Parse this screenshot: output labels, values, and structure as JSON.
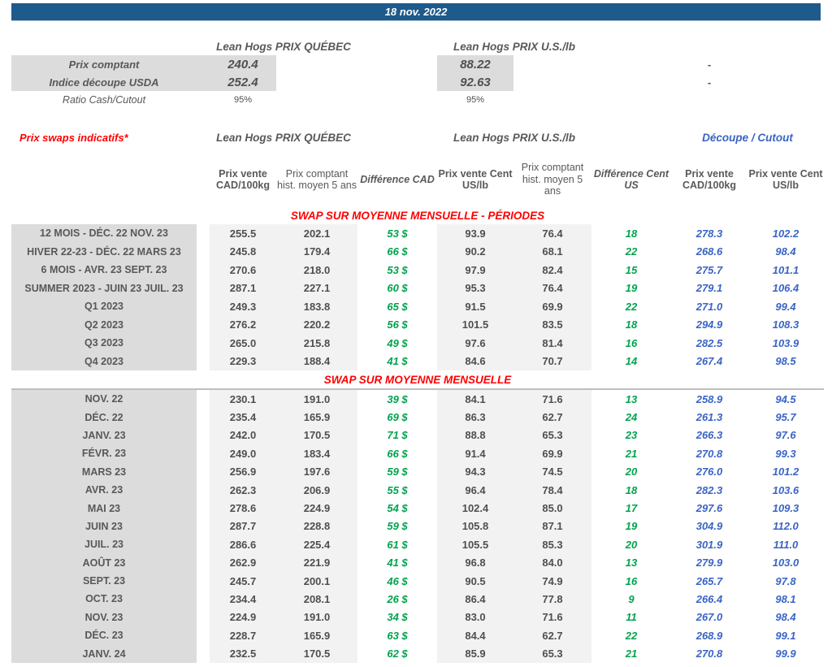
{
  "title_bar": {
    "date": "18 nov. 2022"
  },
  "top_section": {
    "quebec_header": "Lean Hogs PRIX QUÉBEC",
    "us_header": "Lean Hogs PRIX U.S./lb",
    "rows": [
      {
        "label": "Prix comptant",
        "quebec": "240.4",
        "us": "88.22",
        "right": "-"
      },
      {
        "label": "Indice découpe USDA",
        "quebec": "252.4",
        "us": "92.63",
        "right": "-"
      },
      {
        "label": "Ratio Cash/Cutout",
        "quebec": "95%",
        "us": "95%",
        "right": ""
      }
    ]
  },
  "swaps_header": {
    "title": "Prix swaps indicatifs*",
    "quebec_header": "Lean Hogs PRIX QUÉBEC",
    "us_header": "Lean Hogs PRIX U.S./lb",
    "cutout_header": "Découpe / Cutout"
  },
  "column_headers": [
    "Prix vente CAD/100kg",
    "Prix comptant hist. moyen 5 ans",
    "Différence CAD",
    "Prix vente Cent US/lb",
    "Prix comptant hist. moyen 5 ans",
    "Différence Cent US",
    "Prix vente CAD/100kg",
    "Prix vente Cent US/lb"
  ],
  "sections": [
    {
      "heading": "SWAP SUR MOYENNE MENSUELLE - PÉRIODES",
      "rows": [
        {
          "label": "12 MOIS - DÉC. 22 NOV. 23",
          "values": [
            "255.5",
            "202.1",
            "53 $",
            "93.9",
            "76.4",
            "18",
            "278.3",
            "102.2"
          ]
        },
        {
          "label": "HIVER 22-23 - DÉC. 22 MARS 23",
          "values": [
            "245.8",
            "179.4",
            "66 $",
            "90.2",
            "68.1",
            "22",
            "268.6",
            "98.4"
          ]
        },
        {
          "label": "6 MOIS - AVR. 23 SEPT. 23",
          "values": [
            "270.6",
            "218.0",
            "53 $",
            "97.9",
            "82.4",
            "15",
            "275.7",
            "101.1"
          ]
        },
        {
          "label": "SUMMER 2023 - JUIN 23 JUIL. 23",
          "values": [
            "287.1",
            "227.1",
            "60 $",
            "95.3",
            "76.4",
            "19",
            "279.1",
            "106.4"
          ]
        },
        {
          "label": "Q1 2023",
          "values": [
            "249.3",
            "183.8",
            "65 $",
            "91.5",
            "69.9",
            "22",
            "271.0",
            "99.4"
          ]
        },
        {
          "label": "Q2 2023",
          "values": [
            "276.2",
            "220.2",
            "56 $",
            "101.5",
            "83.5",
            "18",
            "294.9",
            "108.3"
          ]
        },
        {
          "label": "Q3 2023",
          "values": [
            "265.0",
            "215.8",
            "49 $",
            "97.6",
            "81.4",
            "16",
            "282.5",
            "103.9"
          ]
        },
        {
          "label": "Q4 2023",
          "values": [
            "229.3",
            "188.4",
            "41 $",
            "84.6",
            "70.7",
            "14",
            "267.4",
            "98.5"
          ]
        }
      ]
    },
    {
      "heading": "SWAP SUR MOYENNE MENSUELLE",
      "rows": [
        {
          "label": "NOV. 22",
          "values": [
            "230.1",
            "191.0",
            "39 $",
            "84.1",
            "71.6",
            "13",
            "258.9",
            "94.5"
          ]
        },
        {
          "label": "DÉC. 22",
          "values": [
            "235.4",
            "165.9",
            "69 $",
            "86.3",
            "62.7",
            "24",
            "261.3",
            "95.7"
          ]
        },
        {
          "label": "JANV. 23",
          "values": [
            "242.0",
            "170.5",
            "71 $",
            "88.8",
            "65.3",
            "23",
            "266.3",
            "97.6"
          ]
        },
        {
          "label": "FÉVR. 23",
          "values": [
            "249.0",
            "183.4",
            "66 $",
            "91.4",
            "69.9",
            "21",
            "270.8",
            "99.3"
          ]
        },
        {
          "label": "MARS 23",
          "values": [
            "256.9",
            "197.6",
            "59 $",
            "94.3",
            "74.5",
            "20",
            "276.0",
            "101.2"
          ]
        },
        {
          "label": "AVR. 23",
          "values": [
            "262.3",
            "206.9",
            "55 $",
            "96.4",
            "78.4",
            "18",
            "282.3",
            "103.6"
          ]
        },
        {
          "label": "MAI 23",
          "values": [
            "278.6",
            "224.9",
            "54 $",
            "102.4",
            "85.0",
            "17",
            "297.6",
            "109.3"
          ]
        },
        {
          "label": "JUIN 23",
          "values": [
            "287.7",
            "228.8",
            "59 $",
            "105.8",
            "87.1",
            "19",
            "304.9",
            "112.0"
          ]
        },
        {
          "label": "JUIL. 23",
          "values": [
            "286.6",
            "225.4",
            "61 $",
            "105.5",
            "85.3",
            "20",
            "301.9",
            "111.0"
          ]
        },
        {
          "label": "AOÛT 23",
          "values": [
            "262.9",
            "221.9",
            "41 $",
            "96.8",
            "84.0",
            "13",
            "279.9",
            "103.0"
          ]
        },
        {
          "label": "SEPT. 23",
          "values": [
            "245.7",
            "200.1",
            "46 $",
            "90.5",
            "74.9",
            "16",
            "265.7",
            "97.8"
          ]
        },
        {
          "label": "OCT. 23",
          "values": [
            "234.4",
            "208.1",
            "26 $",
            "86.4",
            "77.8",
            "9",
            "266.4",
            "98.1"
          ]
        },
        {
          "label": "NOV. 23",
          "values": [
            "224.9",
            "191.0",
            "34 $",
            "83.0",
            "71.6",
            "11",
            "267.0",
            "98.4"
          ]
        },
        {
          "label": "DÉC. 23",
          "values": [
            "228.7",
            "165.9",
            "63 $",
            "84.4",
            "62.7",
            "22",
            "268.9",
            "99.1"
          ]
        },
        {
          "label": "JANV. 24",
          "values": [
            "232.5",
            "170.5",
            "62 $",
            "85.9",
            "65.3",
            "21",
            "270.8",
            "99.9"
          ]
        }
      ]
    }
  ],
  "colors": {
    "banner_blue": "#1E5A8B",
    "heading_red": "#FF0000",
    "difference_green": "#00A24E",
    "cutout_blue": "#3A64C4",
    "text_gray": "#4F4F4F",
    "label_column_bg": "#DCDCDC",
    "band_bg": "#F2F2F2",
    "divider_gray": "#BFBFBF"
  }
}
